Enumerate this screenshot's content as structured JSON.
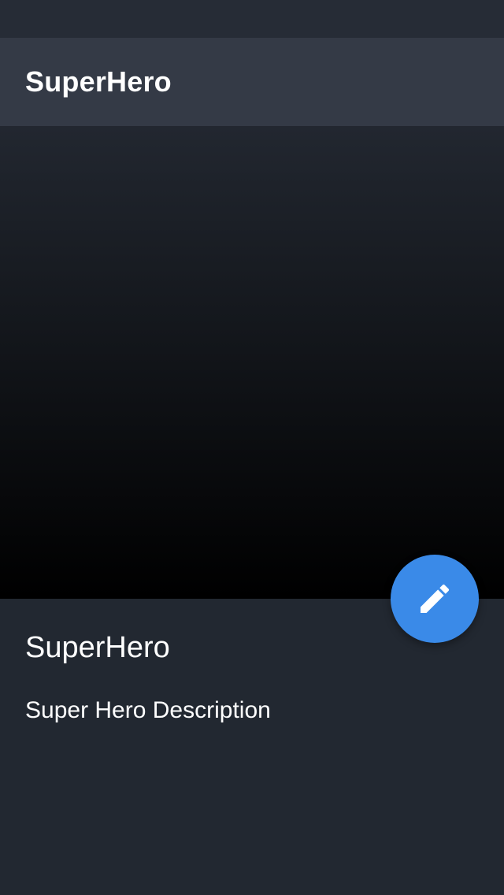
{
  "app_bar": {
    "title": "SuperHero"
  },
  "hero": {
    "name": "SuperHero",
    "description": "Super Hero Description"
  },
  "fab": {
    "icon": "pencil-edit-icon",
    "color": "#3a8ae8"
  },
  "colors": {
    "background": "#222831",
    "app_bar": "#343a46",
    "status_bar": "#262c36",
    "text": "#ffffff"
  }
}
